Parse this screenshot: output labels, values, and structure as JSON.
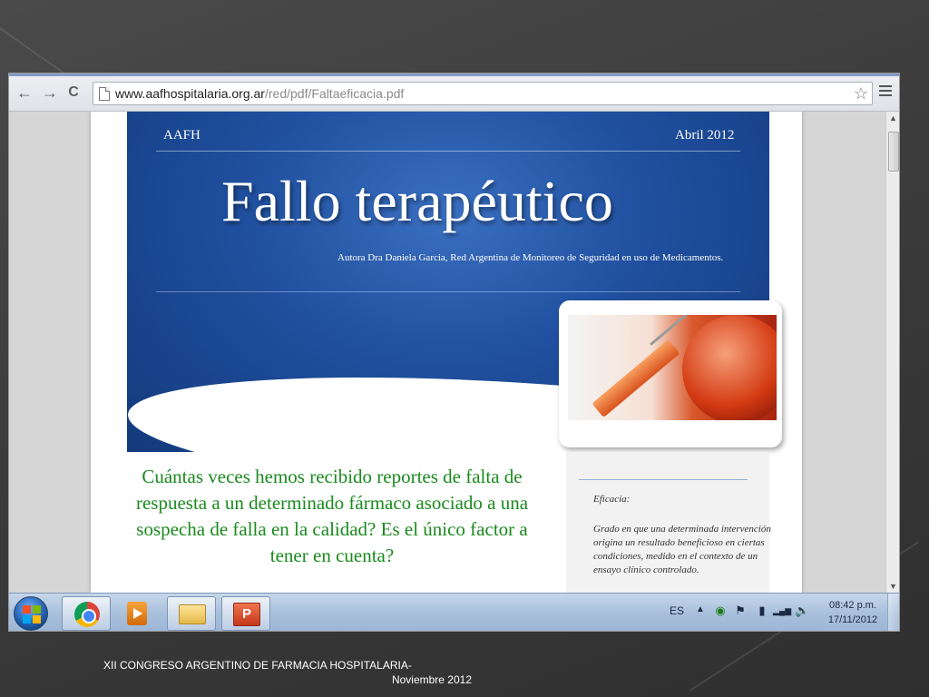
{
  "browser": {
    "url_host": "www.aafhospitalaria.org.ar",
    "url_path": "/red/pdf/Faltaeficacia.pdf",
    "back_icon": "back-arrow-icon",
    "forward_icon": "forward-arrow-icon",
    "reload_icon": "reload-icon",
    "star_icon": "bookmark-star-icon",
    "menu_icon": "hamburger-menu-icon",
    "glyphs": {
      "back": "←",
      "forward": "→",
      "reload": "C",
      "star": "☆",
      "up": "▲",
      "down": "▼"
    }
  },
  "pdf": {
    "header_left": "AAFH",
    "header_right": "Abril 2012",
    "title": "Fallo terapéutico",
    "author": "Autora Dra Daniela Garcia, Red Argentina de Monitoreo de Seguridad en uso de Medicamentos.",
    "question": "Cuántas veces hemos recibido reportes de falta de respuesta a un determinado fármaco asociado a una sospecha de falla en la calidad? Es el único factor a tener en cuenta?",
    "sidebar_heading": "Eficacia:",
    "sidebar_text": "Grado en que una determinada intervención origina un resultado beneficioso en ciertas condiciones, medido en el contexto de un ensayo clínico controlado.",
    "colors": {
      "banner": "#1f4f9e",
      "question_text": "#1a8a1e"
    }
  },
  "taskbar": {
    "language": "ES",
    "tray_up_glyph": "▲",
    "time": "08:42 p.m.",
    "date": "17/11/2012",
    "apps": [
      "chrome-icon",
      "media-player-icon",
      "file-explorer-icon",
      "powerpoint-icon"
    ],
    "tray_glyphs": {
      "network_status": "◉",
      "flag": "⚑",
      "battery": "▮",
      "signal": "▂▄▆",
      "volume": "🔈"
    }
  },
  "footer": {
    "line1": "XII CONGRESO ARGENTINO DE FARMACIA HOSPITALARIA-",
    "line2": "Noviembre 2012"
  }
}
